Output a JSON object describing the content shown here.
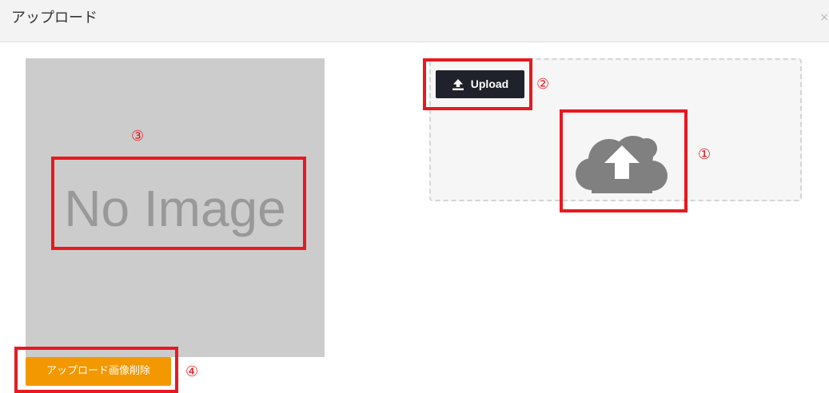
{
  "header": {
    "title": "アップロード",
    "close_glyph": "×"
  },
  "preview": {
    "placeholder_text": "No Image"
  },
  "delete_button": {
    "label": "アップロード画像削除"
  },
  "dropzone": {
    "upload_label": "Upload",
    "upload_icon": "upload-arrow-icon",
    "cloud_icon": "cloud-upload-icon"
  },
  "annotations": {
    "color": "#e8191f",
    "marks": [
      "①",
      "②",
      "③",
      "④"
    ]
  },
  "colors": {
    "upload_button": "#1f222a",
    "delete_button": "#f39800",
    "preview_bg": "#cccccc",
    "cloud": "#808080"
  }
}
